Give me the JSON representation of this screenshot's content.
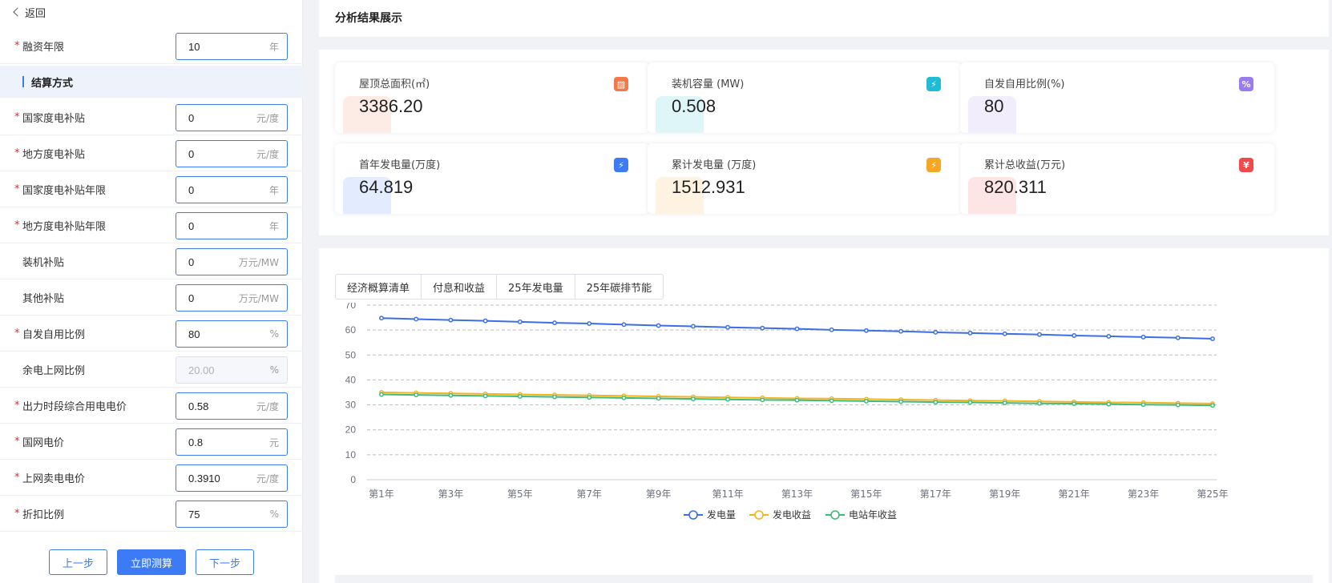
{
  "nav": {
    "back_label": "返回"
  },
  "form": {
    "rows_top": [
      {
        "label": "融资年限",
        "required": true,
        "value": "10",
        "unit": "年"
      }
    ],
    "section_title": "结算方式",
    "rows": [
      {
        "label": "国家度电补贴",
        "required": true,
        "value": "0",
        "unit": "元/度"
      },
      {
        "label": "地方度电补贴",
        "required": true,
        "value": "0",
        "unit": "元/度"
      },
      {
        "label": "国家度电补贴年限",
        "required": true,
        "value": "0",
        "unit": "年"
      },
      {
        "label": "地方度电补贴年限",
        "required": true,
        "value": "0",
        "unit": "年"
      },
      {
        "label": "装机补贴",
        "required": false,
        "value": "0",
        "unit": "万元/MW"
      },
      {
        "label": "其他补贴",
        "required": false,
        "value": "0",
        "unit": "万元/MW"
      },
      {
        "label": "自发自用比例",
        "required": true,
        "value": "80",
        "unit": "%"
      },
      {
        "label": "余电上网比例",
        "required": false,
        "value": "20.00",
        "unit": "%",
        "disabled": true
      },
      {
        "label": "出力时段综合用电电价",
        "required": true,
        "value": "0.58",
        "unit": "元/度"
      },
      {
        "label": "国网电价",
        "required": true,
        "value": "0.8",
        "unit": "元"
      },
      {
        "label": "上网卖电电价",
        "required": true,
        "value": "0.3910",
        "unit": "元/度"
      },
      {
        "label": "折扣比例",
        "required": true,
        "value": "75",
        "unit": "%"
      }
    ],
    "buttons": {
      "prev": "上一步",
      "calc": "立即测算",
      "next": "下一步"
    }
  },
  "results": {
    "title": "分析结果展示",
    "stats": [
      {
        "label": "屋顶总面积(㎡)",
        "value": "3386.20",
        "color": "#f07a4a",
        "icon": "roof-area-icon",
        "glyph": "▨"
      },
      {
        "label": "装机容量 (MW)",
        "value": "0.508",
        "color": "#1ebcd6",
        "icon": "battery-icon",
        "glyph": "⚡"
      },
      {
        "label": "自发自用比例(%)",
        "value": "80",
        "color": "#9b7cf0",
        "icon": "percent-icon",
        "glyph": "%"
      },
      {
        "label": "首年发电量(万度)",
        "value": "64.819",
        "color": "#3c7bf5",
        "icon": "power-badge-icon",
        "glyph": "⚡"
      },
      {
        "label": "累计发电量 (万度)",
        "value": "1512.931",
        "color": "#f5a623",
        "icon": "energy-icon",
        "glyph": "⚡"
      },
      {
        "label": "累计总收益(万元)",
        "value": "820.311",
        "color": "#f04a4a",
        "icon": "money-bag-icon",
        "glyph": "¥"
      }
    ],
    "tabs": [
      "经济概算清单",
      "付息和收益",
      "25年发电量",
      "25年碳排节能"
    ]
  },
  "chart_data": {
    "type": "line",
    "categories": [
      "第1年",
      "第2年",
      "第3年",
      "第4年",
      "第5年",
      "第6年",
      "第7年",
      "第8年",
      "第9年",
      "第10年",
      "第11年",
      "第12年",
      "第13年",
      "第14年",
      "第15年",
      "第16年",
      "第17年",
      "第18年",
      "第19年",
      "第20年",
      "第21年",
      "第22年",
      "第23年",
      "第24年",
      "第25年"
    ],
    "x_tick_labels": [
      "第1年",
      "第3年",
      "第5年",
      "第7年",
      "第9年",
      "第11年",
      "第13年",
      "第15年",
      "第17年",
      "第19年",
      "第21年",
      "第23年",
      "第25年"
    ],
    "ylim": [
      0,
      70
    ],
    "y_ticks": [
      0,
      10,
      20,
      30,
      40,
      50,
      60,
      70
    ],
    "grid": true,
    "legend": "bottom-center",
    "series": [
      {
        "name": "发电量",
        "color": "#3c6ee6",
        "values": [
          64.8,
          64.4,
          64.0,
          63.7,
          63.3,
          62.9,
          62.6,
          62.2,
          61.8,
          61.5,
          61.1,
          60.8,
          60.5,
          60.1,
          59.8,
          59.5,
          59.1,
          58.8,
          58.5,
          58.2,
          57.8,
          57.5,
          57.2,
          56.9,
          56.5
        ]
      },
      {
        "name": "发电收益",
        "color": "#f5b21c",
        "values": [
          35.0,
          34.8,
          34.6,
          34.4,
          34.2,
          34.0,
          33.8,
          33.6,
          33.4,
          33.2,
          33.0,
          32.8,
          32.6,
          32.5,
          32.3,
          32.1,
          31.9,
          31.7,
          31.6,
          31.4,
          31.2,
          31.0,
          30.9,
          30.7,
          30.5
        ]
      },
      {
        "name": "电站年收益",
        "color": "#3dbb7a",
        "values": [
          34.2,
          34.0,
          33.8,
          33.6,
          33.4,
          33.2,
          33.0,
          32.8,
          32.6,
          32.4,
          32.2,
          32.0,
          31.9,
          31.7,
          31.5,
          31.3,
          31.1,
          31.0,
          30.8,
          30.6,
          30.5,
          30.3,
          30.1,
          30.0,
          29.8
        ]
      }
    ]
  }
}
